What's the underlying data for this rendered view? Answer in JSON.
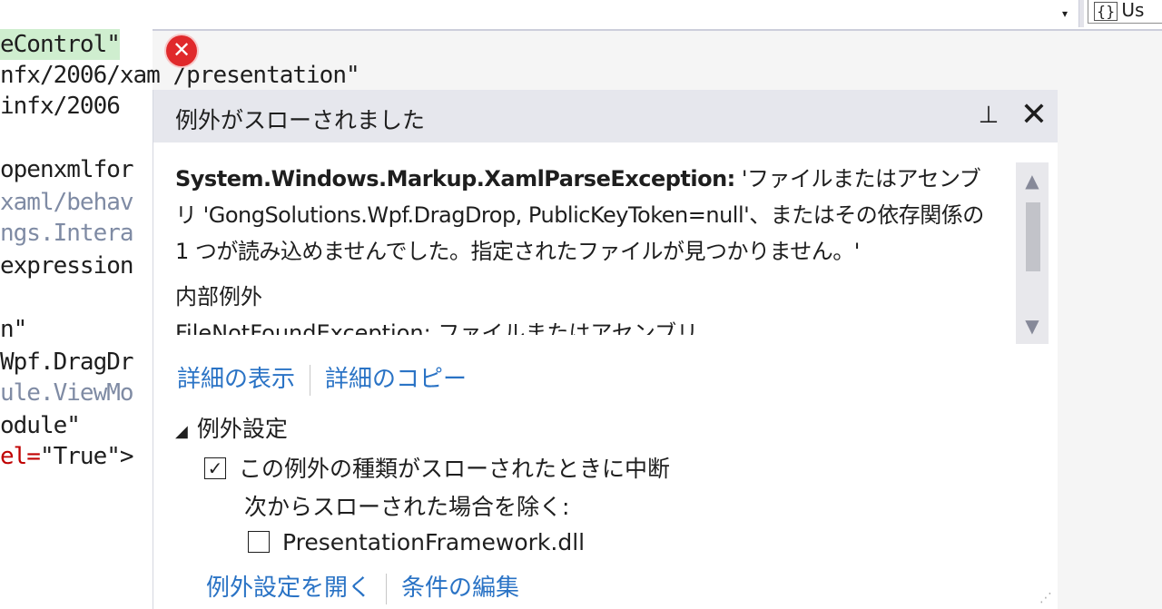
{
  "toolbar": {
    "dropdown_arrow": "▾",
    "scope_label": "Us"
  },
  "editor": {
    "lines": [
      {
        "text": "eControl\"",
        "color": "black"
      },
      {
        "text": "infx/2006",
        "color": "black"
      },
      {
        "text": "openxmlfor",
        "color": "black"
      },
      {
        "text": "xaml/behav",
        "color": "gray"
      },
      {
        "text": "ngs.Intera",
        "color": "gray"
      },
      {
        "text": "expression",
        "color": "black"
      },
      {
        "text": "n\"",
        "color": "black"
      },
      {
        "text": "Wpf.DragDr",
        "color": "black"
      },
      {
        "text": "ule.ViewMo",
        "color": "gray"
      },
      {
        "text": "odule\"",
        "color": "black"
      },
      {
        "text_red": "el=",
        "text": "\"True\">"
      }
    ],
    "xam_line": "nfx/2006/xam /presentation\"",
    "error_glyph": "✕"
  },
  "popup": {
    "title": "例外がスローされました",
    "pin_icon": "⊥",
    "close_icon": "✕",
    "exception_type": "System.Windows.Markup.XamlParseException:",
    "message": " 'ファイルまたはアセンブリ 'GongSolutions.Wpf.DragDrop, PublicKeyToken=null'、またはその依存関係の 1 つが読み込めませんでした。指定されたファイルが見つかりません。'",
    "inner_label": "内部例外",
    "inner_value": "FileNotFoundException: ファイルまたはアセンブリ",
    "scroll_up": "▲",
    "scroll_down": "▼",
    "link_details": "詳細の表示",
    "link_copy": "詳細のコピー",
    "settings_header": "例外設定",
    "settings_triangle": "◢",
    "checkbox_break_label": "この例外の種類がスローされたときに中断",
    "checkbox_break_checked": "✓",
    "except_when_label": "次からスローされた場合を除く:",
    "checkbox_dll_label": "PresentationFramework.dll",
    "link_open_settings": "例外設定を開く",
    "link_edit_conditions": "条件の編集",
    "resize_grip": "⋰"
  }
}
